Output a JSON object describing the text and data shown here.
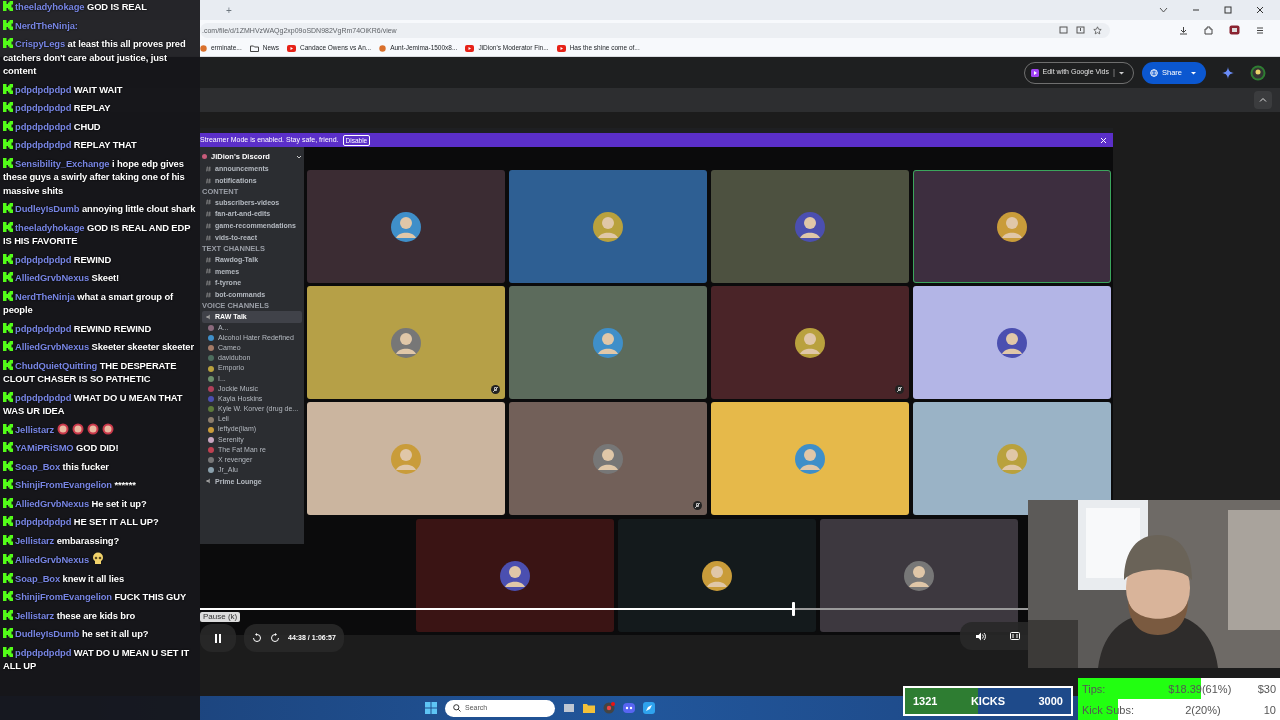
{
  "browser": {
    "new_tab": "+",
    "url": ".com/file/d/1ZMHVzWAQg2xp09oSDN982VgRm74OiKR6/view",
    "bookmarks": [
      {
        "kind": "site",
        "label": "erminate..."
      },
      {
        "kind": "folder",
        "label": "News"
      },
      {
        "kind": "video",
        "label": "Candace Owens vs An..."
      },
      {
        "kind": "site",
        "label": "Aunt-Jemima-1500x8..."
      },
      {
        "kind": "video",
        "label": "JiDion's Moderator Fin..."
      },
      {
        "kind": "video",
        "label": "Has the shine come of..."
      }
    ]
  },
  "drive": {
    "edit_button": "Edit with Google Vids",
    "share_button": "Share"
  },
  "discord": {
    "banner": "Streamer Mode is enabled. Stay safe, friend.",
    "banner_button": "Disable",
    "server": "JiDion's Discord",
    "channels": [
      {
        "kind": "channel",
        "name": "announcements",
        "selected": false
      },
      {
        "kind": "channel",
        "name": "notifications",
        "selected": false
      },
      {
        "kind": "category",
        "name": "CONTENT"
      },
      {
        "kind": "channel",
        "name": "subscribers-videos",
        "selected": false
      },
      {
        "kind": "channel",
        "name": "fan-art-and-edits",
        "selected": false
      },
      {
        "kind": "channel",
        "name": "game-recommendations",
        "selected": false
      },
      {
        "kind": "channel",
        "name": "vids-to-react",
        "selected": false
      },
      {
        "kind": "category",
        "name": "TEXT CHANNELS"
      },
      {
        "kind": "channel",
        "name": "Rawdog-Talk",
        "selected": false
      },
      {
        "kind": "channel",
        "name": "memes",
        "selected": false
      },
      {
        "kind": "channel",
        "name": "f-tyrone",
        "selected": false
      },
      {
        "kind": "channel",
        "name": "bot-commands",
        "selected": false
      },
      {
        "kind": "category",
        "name": "VOICE CHANNELS"
      },
      {
        "kind": "voice",
        "name": "RAW Talk",
        "selected": true
      },
      {
        "kind": "member",
        "name": "A..."
      },
      {
        "kind": "member",
        "name": "Alcohol Hater Redefined"
      },
      {
        "kind": "member",
        "name": "Cameo"
      },
      {
        "kind": "member",
        "name": "davidubon"
      },
      {
        "kind": "member",
        "name": "Emporio"
      },
      {
        "kind": "member",
        "name": "I..."
      },
      {
        "kind": "member",
        "name": "Jockie Music"
      },
      {
        "kind": "member",
        "name": "Kayla Hoskins"
      },
      {
        "kind": "member",
        "name": "Kyle W. Korver (drug de..."
      },
      {
        "kind": "member",
        "name": "Leli"
      },
      {
        "kind": "member",
        "name": "leftyde(liam)"
      },
      {
        "kind": "member",
        "name": "Serenity"
      },
      {
        "kind": "member",
        "name": "The Fat Man re"
      },
      {
        "kind": "member",
        "name": "X revenger"
      },
      {
        "kind": "member",
        "name": "Jr_Alu"
      },
      {
        "kind": "voice",
        "name": "Prime Lounge",
        "selected": false
      }
    ],
    "tiles": [
      {
        "color": "#3b2c33",
        "speaking": false
      },
      {
        "color": "#2e5f93",
        "speaking": false
      },
      {
        "color": "#4d5140",
        "speaking": false
      },
      {
        "color": "#3d2e3f",
        "speaking": true
      },
      {
        "color": "#b6a047",
        "speaking": false,
        "muted": true
      },
      {
        "color": "#5c6b5c",
        "speaking": false
      },
      {
        "color": "#4a2428",
        "speaking": false,
        "muted": true
      },
      {
        "color": "#b3b5e6",
        "speaking": false
      },
      {
        "color": "#cbb59f",
        "speaking": false
      },
      {
        "color": "#726059",
        "speaking": false,
        "muted": true
      },
      {
        "color": "#e6b94a",
        "speaking": false
      },
      {
        "color": "#9ab3c6",
        "speaking": false
      },
      {
        "color": "#3a1414",
        "speaking": false
      },
      {
        "color": "#141a1c",
        "speaking": false
      },
      {
        "color": "#3d383f",
        "speaking": false
      }
    ]
  },
  "player": {
    "tooltip": "Pause (k)",
    "time": "44:38 / 1:06:57",
    "level": 0.716,
    "playing": true
  },
  "chat": [
    {
      "kind": "text",
      "user": "theeladyhokage",
      "text": "GOD IS REAL"
    },
    {
      "kind": "text",
      "user": "NerdTheNinja:"
    },
    {
      "kind": "text",
      "user": "CrispyLegs",
      "text": "at least this all proves pred catchers don't care about justice, just content"
    },
    {
      "kind": "text",
      "user": "pdpdpdpdpd",
      "text": "WAIT WAIT"
    },
    {
      "kind": "text",
      "user": "pdpdpdpdpd",
      "text": "REPLAY"
    },
    {
      "kind": "text",
      "user": "pdpdpdpdpd",
      "text": "CHUD"
    },
    {
      "kind": "text",
      "user": "pdpdpdpdpd",
      "text": "REPLAY THAT"
    },
    {
      "kind": "text",
      "user": "Sensibility_Exchange",
      "text": "i hope edp gives these guys a swirly after taking one of his massive shits"
    },
    {
      "kind": "text",
      "user": "DudleyIsDumb",
      "text": "annoying little clout shark"
    },
    {
      "kind": "text",
      "user": "theeladyhokage",
      "text": "GOD IS REAL AND EDP IS HIS FAVORITE"
    },
    {
      "kind": "text",
      "user": "pdpdpdpdpd",
      "text": "REWIND"
    },
    {
      "kind": "text",
      "user": "AlliedGrvbNexus",
      "text": "Skeet!"
    },
    {
      "kind": "text",
      "user": "NerdTheNinja",
      "text": "what a smart group of people"
    },
    {
      "kind": "text",
      "user": "pdpdpdpdpd",
      "text": "REWIND REWIND"
    },
    {
      "kind": "text",
      "user": "AlliedGrvbNexus",
      "text": "Skeeter skeeter skeeter"
    },
    {
      "kind": "text",
      "user": "ChudQuietQuitting",
      "text": "THE DESPERATE CLOUT CHASER IS SO PATHETIC"
    },
    {
      "kind": "text",
      "user": "pdpdpdpdpd",
      "text": "WHAT DO U MEAN THAT WAS UR IDEA"
    },
    {
      "kind": "emotes",
      "user": "Jellistarz",
      "emotes": [
        {
          "kind": "face"
        },
        {
          "kind": "face"
        },
        {
          "kind": "face"
        },
        {
          "kind": "face"
        }
      ]
    },
    {
      "kind": "text",
      "user": "YAMiPRiSMO",
      "text": "GOD DID!"
    },
    {
      "kind": "text",
      "user": "Soap_Box",
      "text": "this fucker"
    },
    {
      "kind": "text",
      "user": "ShinjiFromEvangelion",
      "text": "******"
    },
    {
      "kind": "text",
      "user": "AlliedGrvbNexus",
      "text": "He set it up?"
    },
    {
      "kind": "text",
      "user": "pdpdpdpdpd",
      "text": "HE SET IT ALL UP?"
    },
    {
      "kind": "text",
      "user": "Jellistarz",
      "text": "embarassing?"
    },
    {
      "kind": "emotes",
      "user": "AlliedGrvbNexus",
      "emotes": [
        {
          "kind": "skull"
        }
      ]
    },
    {
      "kind": "text",
      "user": "Soap_Box",
      "text": "knew it all lies"
    },
    {
      "kind": "text",
      "user": "ShinjiFromEvangelion",
      "text": "FUCK THIS GUY"
    },
    {
      "kind": "text",
      "user": "Jellistarz",
      "text": "these are kids bro"
    },
    {
      "kind": "text",
      "user": "DudleyIsDumb",
      "text": "he set it all up?"
    },
    {
      "kind": "text",
      "user": "pdpdpdpdpd",
      "text": "WAT DO U MEAN U SET IT ALL UP"
    }
  ],
  "taskbar": {
    "search_placeholder": "Search"
  },
  "goal": {
    "current": "1321",
    "label": "KICKS",
    "target": "3000",
    "level": 0.44
  },
  "stats": [
    {
      "label": "Tips:",
      "value": "$18.39(61%)",
      "target": "$30",
      "level": 0.61
    },
    {
      "label": "Kick Subs:",
      "value": "2(20%)",
      "target": "10",
      "level": 0.2
    }
  ]
}
